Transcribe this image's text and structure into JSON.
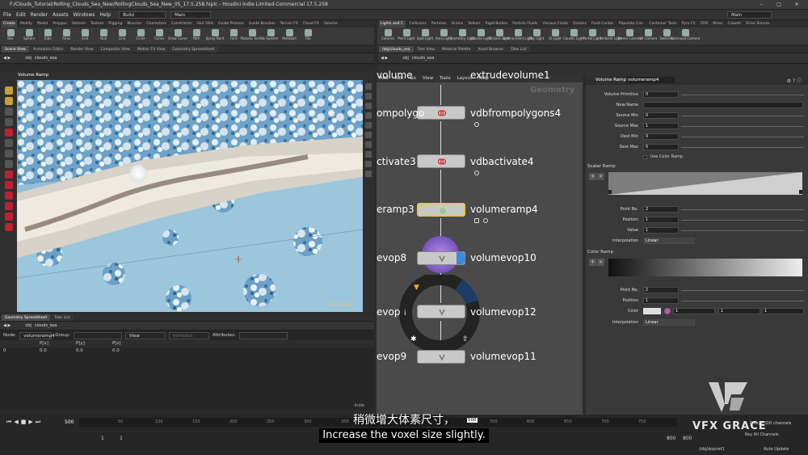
{
  "window": {
    "title": "F:/Clouds_Tutorial/Rolling_Clouds_Sea_New/RollingClouds_Sea_New_05_17.5.258.hiplc - Houdini Indie Limited-Commercial 17.5.258",
    "minimize": "–",
    "maximize": "□",
    "close": "✕"
  },
  "menu": {
    "items": [
      "File",
      "Edit",
      "Render",
      "Assets",
      "Windows",
      "Help"
    ],
    "build": "Build",
    "main": "Main"
  },
  "shelf_tabs_left": [
    "Create",
    "Modify",
    "Model",
    "Polygon",
    "Deform",
    "Texture",
    "Rigging",
    "Muscles",
    "Characters",
    "Constraints",
    "Hair Utils",
    "Guide Process",
    "Guide Brushes",
    "Terrain FX",
    "Cloud FX",
    "Volume"
  ],
  "shelf_tabs_right": [
    "Lights and C.",
    "Collisions",
    "Particles",
    "Grains",
    "Vellum",
    "Rigid Bodies",
    "Particle Fluids",
    "Viscous Fluids",
    "Oceans",
    "Fluid Contai.",
    "Populate Con.",
    "Container Tools",
    "Pyro FX",
    "FEM",
    "Wires",
    "Crowds",
    "Drive Simula."
  ],
  "tools_left": [
    "Box",
    "Sphere",
    "Tube",
    "Torus",
    "Grid",
    "Null",
    "Line",
    "Circle",
    "Curve",
    "Draw Curve",
    "Path",
    "Spray Paint",
    "Font",
    "Platonic Solids",
    "L-System",
    "Metaball",
    "File"
  ],
  "tools_right": [
    "Camera",
    "Point Light",
    "Spot Light",
    "Area Light",
    "Geometry Light",
    "Volume Light",
    "Distant Light",
    "Environment Light",
    "Sky Light",
    "GI Light",
    "Caustic Light",
    "Portal Light",
    "Ambient Light",
    "Stereo Camera",
    "VR Camera",
    "Switcher",
    "Gamepad Camera"
  ],
  "left_panel": {
    "tabs": [
      "Scene View",
      "Animation Editor",
      "Render View",
      "Composite View",
      "Motion FX View",
      "Geometry Spreadsheet"
    ],
    "path_obj": "obj",
    "path_node": "clouds_sea",
    "toolbar_title": "Volume Ramp",
    "watermark": "Indie Edition"
  },
  "spreadsheet": {
    "tabs": [
      "Geometry Spreadsheet",
      "Take List"
    ],
    "path_obj": "obj",
    "path_node": "clouds_sea",
    "node_label": "Node:",
    "node_value": "volumeramp4",
    "group_label": "Group:",
    "view_label": "View",
    "intrinsics_label": "Intrinsics",
    "attributes_label": "Attributes:",
    "columns": [
      "",
      "P[x]",
      "P[y]",
      "P[z]"
    ],
    "rows": [
      [
        "0",
        "0.0",
        "0.0",
        "0.0"
      ]
    ],
    "footer": "Indie"
  },
  "network": {
    "tabs": [
      "/obj/clouds_sea",
      "Tree View",
      "Material Palette",
      "Asset Browser",
      "Take List"
    ],
    "path_obj": "obj",
    "path_node": "clouds_sea",
    "menu": [
      "Add",
      "Edit",
      "Go",
      "View",
      "Tools",
      "Layout",
      "Help"
    ],
    "context_label": "Geometry",
    "nodes": [
      {
        "name": "extrudevolume1",
        "left_label": "volume"
      },
      {
        "name": "vdbfrompolygons4",
        "left_label": "ompolygo"
      },
      {
        "name": "vdbactivate4",
        "left_label": "ctivate3"
      },
      {
        "name": "volumeramp4",
        "left_label": "eramp3"
      },
      {
        "name": "volumevop10",
        "left_label": "evop8"
      },
      {
        "name": "volumevop12",
        "left_label": "evop"
      },
      {
        "name": "volumevop11",
        "left_label": "evop9"
      }
    ]
  },
  "params": {
    "node_type": "Volume Ramp",
    "node_name": "volumeramp4",
    "fields": [
      {
        "label": "Volume Primitive",
        "value": "0"
      },
      {
        "label": "New Name",
        "value": ""
      },
      {
        "label": "Source Min",
        "value": "0"
      },
      {
        "label": "Source Max",
        "value": "1"
      },
      {
        "label": "Dest Min",
        "value": "0"
      },
      {
        "label": "Dest Max",
        "value": "6"
      }
    ],
    "use_color_ramp": "Use Color Ramp",
    "scalar_ramp": {
      "title": "Scalar Ramp",
      "point_no_label": "Point No.",
      "point_no": "2",
      "position_label": "Position",
      "position": "1",
      "value_label": "Value",
      "value": "1",
      "interp_label": "Interpolation",
      "interp": "Linear"
    },
    "color_ramp": {
      "title": "Color Ramp",
      "point_no_label": "Point No.",
      "point_no": "2",
      "position_label": "Position",
      "position": "1",
      "color_label": "Color",
      "color_r": "1",
      "color_g": "1",
      "color_b": "1",
      "interp_label": "Interpolation",
      "interp": "Linear"
    }
  },
  "timeline": {
    "frame": "500",
    "start": "1",
    "start2": "1",
    "end": "800",
    "end2": "800",
    "ticks": [
      "",
      "50",
      "100",
      "150",
      "200",
      "250",
      "300",
      "350",
      "400",
      "450",
      "",
      "550",
      "600",
      "650",
      "700",
      "750"
    ],
    "keys_label": "0 keys, 0/0 channels",
    "key_all": "Key All Channels",
    "path": "/obj/dopnet1",
    "auto_update": "Auto Update",
    "current": "500"
  },
  "subtitle": {
    "cn": "稍微增大体素尺寸，",
    "en": "Increase the voxel size slightly."
  },
  "logo": {
    "text": "VFX GRACE"
  }
}
